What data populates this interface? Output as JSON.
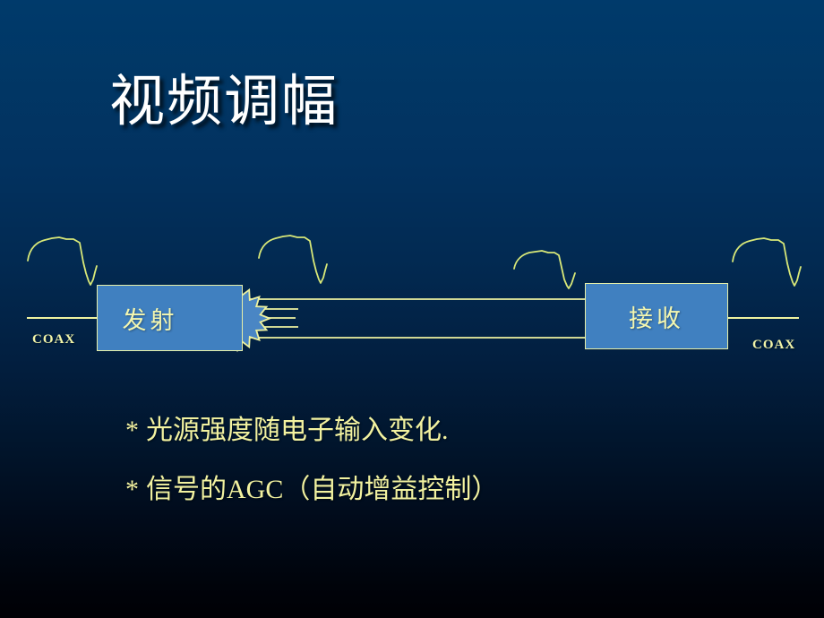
{
  "slide": {
    "title": "视频调幅",
    "background": {
      "top_color": "#003a6b",
      "bottom_color": "#000005"
    }
  },
  "diagram": {
    "accent_line_color": "#eef2a0",
    "box_fill_color": "#4080c0",
    "box_border_color": "#e8f0a8",
    "transmitter": {
      "label": "发射",
      "name": "transmitter-block"
    },
    "receiver": {
      "label": "接收",
      "name": "receiver-block"
    },
    "light_source": {
      "name": "starburst-light-source",
      "points": 16
    },
    "coax_left_label": "COAX",
    "coax_right_label": "COAX",
    "waveform_count": 4
  },
  "bullets": [
    {
      "marker": "*",
      "text": "光源强度随电子输入变化."
    },
    {
      "marker": "*",
      "text": "信号的AGC（自动增益控制）"
    }
  ]
}
